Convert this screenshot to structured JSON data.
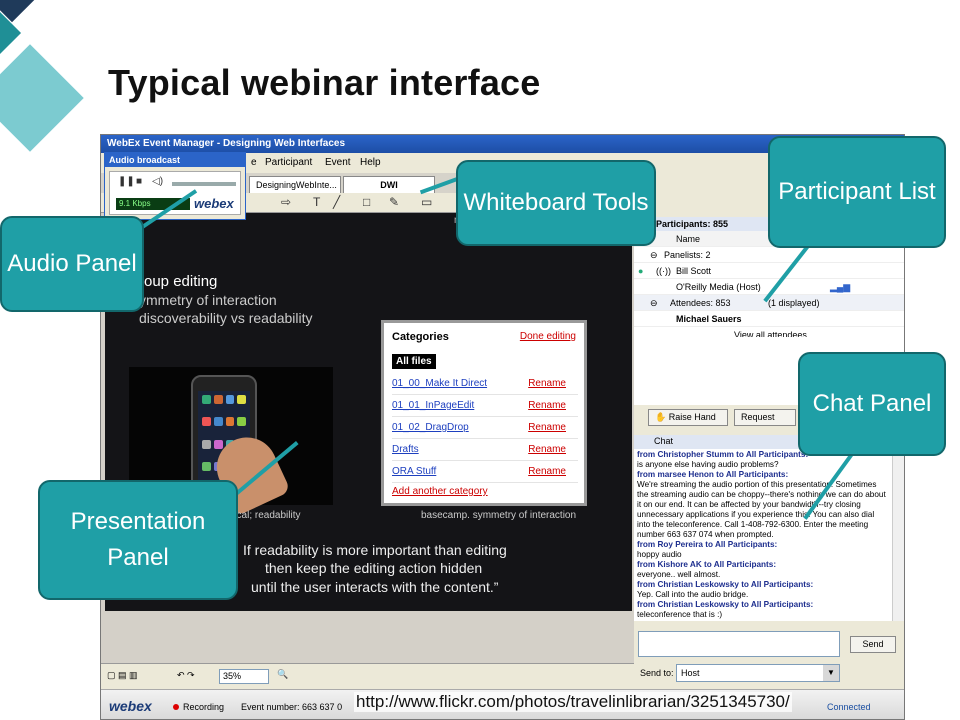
{
  "slide": {
    "title": "Typical webinar interface",
    "source_url": "http://www.flickr.com/photos/travelinlibrarian/3251345730/"
  },
  "app": {
    "window_title": "WebEx Event Manager - Designing Web Interfaces",
    "menu": [
      "e",
      "Participant",
      "Event",
      "Help"
    ],
    "tabs": [
      "DesigningWebInte...",
      "DWI"
    ],
    "toolbar_icons": [
      "arrow-icon",
      "text-icon",
      "line-icon",
      "rectangle-icon",
      "pen-icon",
      "eraser-icon"
    ]
  },
  "audio_panel": {
    "title": "Audio broadcast",
    "rate": "9.1 Kbps",
    "logo": "webex"
  },
  "presentation": {
    "hidden_label": "m",
    "heading": "roup editing",
    "subs": [
      "ymmetry of interaction",
      "discoverability vs readability"
    ],
    "caption_left": "rical; readability",
    "caption_right": "basecamp. symmetry of interaction",
    "quote": [
      "If readability is more important than editing",
      "then keep the editing action hidden",
      "until the user interacts with the content.”"
    ],
    "categories": {
      "title": "Categories",
      "done": "Done editing",
      "all_files": "All files",
      "rows": [
        {
          "name": "01_00_Make It Direct",
          "action": "Rename"
        },
        {
          "name": "01_01_InPageEdit",
          "action": "Rename"
        },
        {
          "name": "01_02_DragDrop",
          "action": "Rename"
        },
        {
          "name": "Drafts",
          "action": "Rename"
        },
        {
          "name": "ORA Stuff",
          "action": "Rename"
        }
      ],
      "add": "Add another category"
    }
  },
  "participants": {
    "header": "Participants: 855",
    "col_name": "Name",
    "panelists": "Panelists: 2",
    "p1": "Bill Scott",
    "p2": "O'Reilly Media (Host)",
    "attendees": "Attendees: 853",
    "displayed": "(1 displayed)",
    "a1": "Michael Sauers",
    "view_all": "View all attendees...",
    "raise_hand": "Raise Hand",
    "request": "Request"
  },
  "chat": {
    "header": "Chat",
    "messages": [
      {
        "from": "from Christopher Stumm to All Participants:",
        "text": "is anyone else having audio problems?"
      },
      {
        "from": "from marsee Henon to All Participants:",
        "text": "We're streaming the audio portion of this presentation. Sometimes the streaming audio can be choppy--there's nothing we can do about it on our end. It can be affected by your bandwidth--try closing unnecessary applications if you experience this. You can also dial into the teleconference. Call 1-408-792-6300. Enter the meeting number 663 637 074 when prompted."
      },
      {
        "from": "from Roy Pereira to All Participants:",
        "text": "hoppy audio"
      },
      {
        "from": "from Kishore AK to All Participants:",
        "text": "everyone.. well almost."
      },
      {
        "from": "from Christian Leskowsky to All Participants:",
        "text": "Yep. Call into the audio bridge."
      },
      {
        "from": "from Christian Leskowsky to All Participants:",
        "text": "teleconference that is :)"
      }
    ],
    "send": "Send",
    "send_to_label": "Send to:",
    "send_to_value": "Host"
  },
  "bottom": {
    "zoom": "35%",
    "logo": "webex",
    "recording": "Recording",
    "event_number": "Event number: 663 637 0",
    "connected": "Connected"
  },
  "callouts": {
    "audio": "Audio Panel",
    "whiteboard": "Whiteboard Tools",
    "participant": "Participant List",
    "chat": "Chat Panel",
    "presentation": "Presentation Panel"
  },
  "colors": {
    "callout": "#1f9fa6",
    "navy": "#1f3a5a",
    "teal": "#1f8f96",
    "light_teal": "#7ccbd0"
  }
}
